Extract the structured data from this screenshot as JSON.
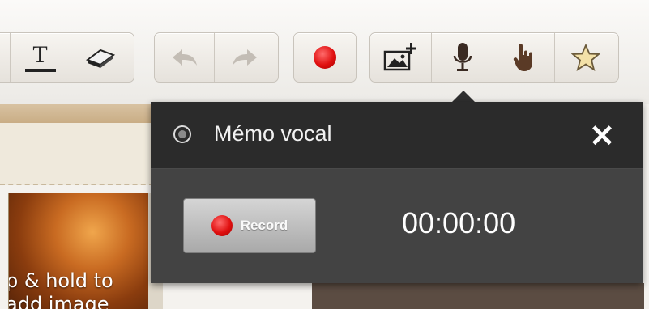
{
  "toolbar": {
    "icons": [
      "text-icon",
      "eraser-icon",
      "undo-icon",
      "redo-icon",
      "record-icon",
      "add-image-icon",
      "microphone-icon",
      "pointer-hand-icon",
      "star-icon"
    ]
  },
  "canvas": {
    "photo_text": "p & hold to\nadd image"
  },
  "popup": {
    "title": "Mémo vocal",
    "close_icon": "close-icon",
    "record_label": "Record",
    "timer": "00:00:00"
  },
  "colors": {
    "record_red": "#e01010",
    "popup_bg": "#2f2f2f",
    "popup_body": "#434343"
  }
}
